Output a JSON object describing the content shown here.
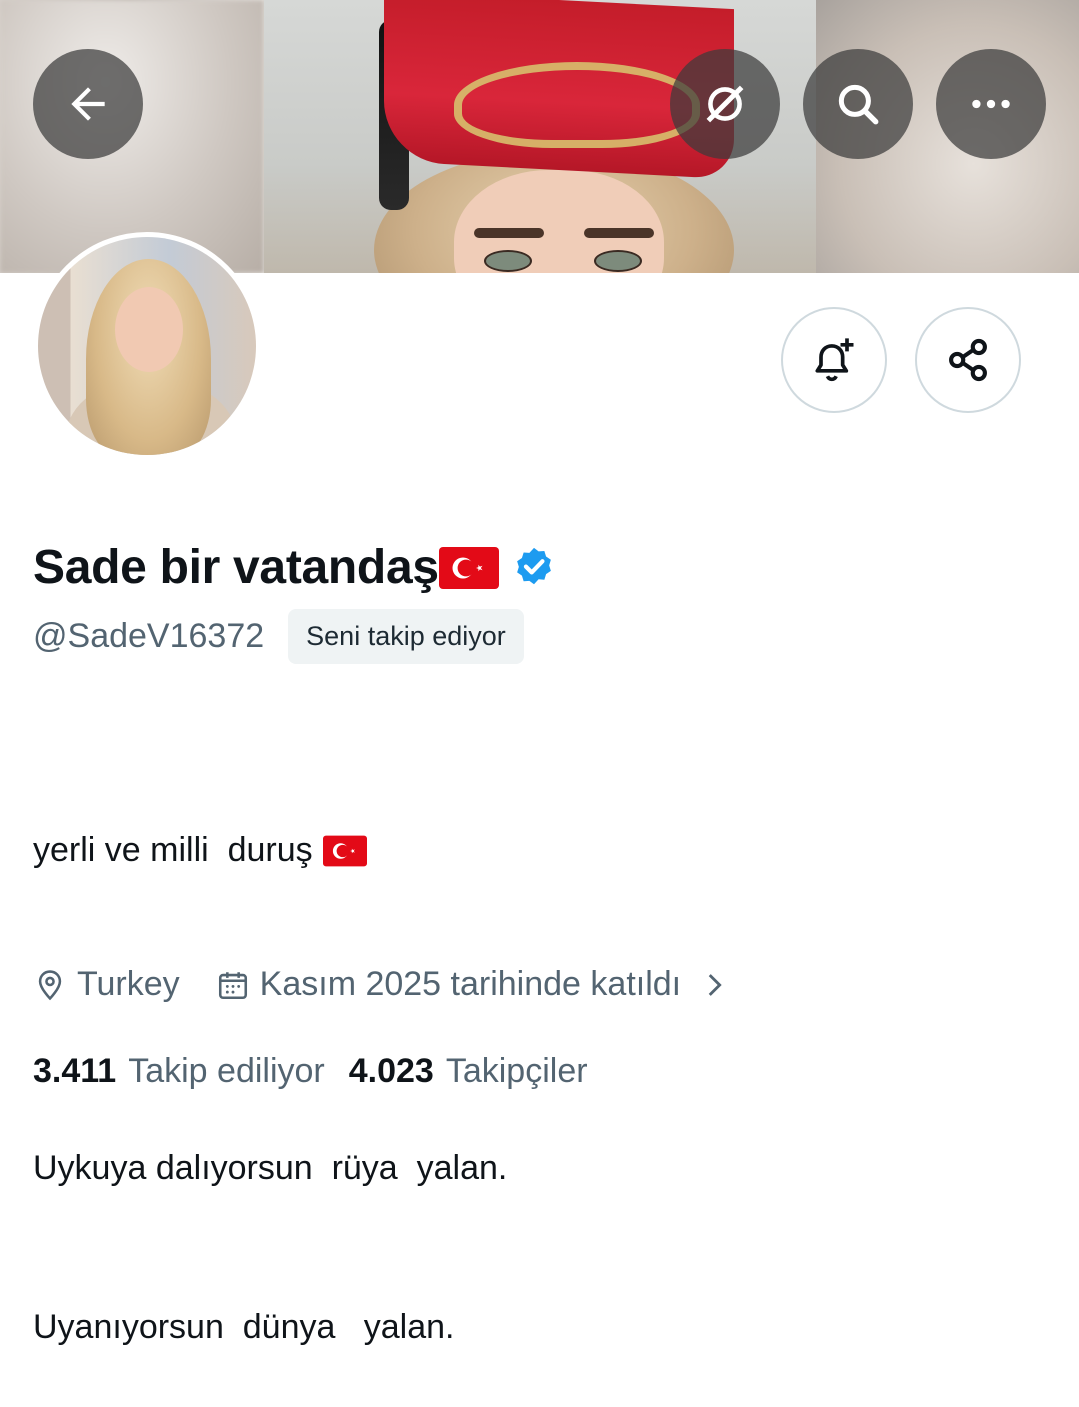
{
  "header": {
    "back_icon": "arrow-left-icon",
    "grok_icon": "grok-icon",
    "search_icon": "search-icon",
    "more_icon": "more-horizontal-icon"
  },
  "profile": {
    "display_name": "Sade bir vatandaş",
    "name_emoji": "turkey-flag",
    "verified": true,
    "verified_color": "#1d9bf0",
    "handle": "@SadeV16372",
    "follows_you": "Seni takip ediyor",
    "bio_lines": [
      "yerli ve milli  duruş",
      "",
      "Uykuya dalıyorsun  rüya  yalan.",
      "Uyanıyorsun  dünya   yalan."
    ],
    "location": "Turkey",
    "joined": "Kasım 2025 tarihinde katıldı",
    "following_count": "3.411",
    "following_label": "Takip ediliyor",
    "followers_count": "4.023",
    "followers_label": "Takipçiler"
  },
  "actions": {
    "notify_icon": "bell-plus-icon",
    "share_icon": "share-icon"
  },
  "colors": {
    "text": "#0f1419",
    "secondary": "#536471",
    "border": "#cfd9de",
    "flag_red": "#e30a17"
  }
}
